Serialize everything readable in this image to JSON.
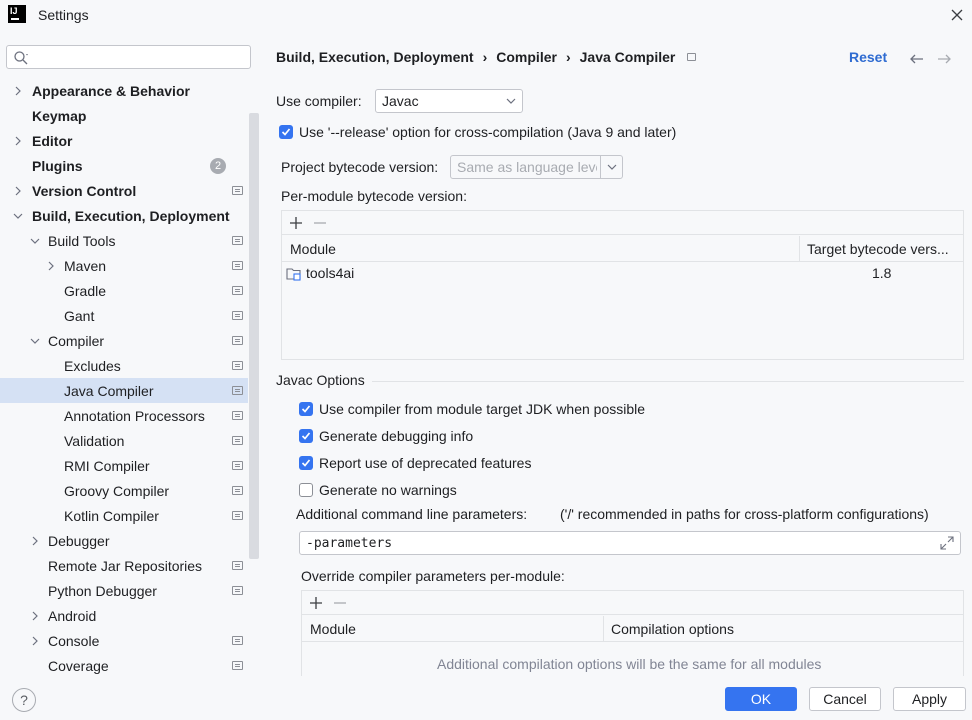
{
  "window": {
    "title": "Settings"
  },
  "sidebar": {
    "search_placeholder": "",
    "items": [
      {
        "label": "Appearance & Behavior"
      },
      {
        "label": "Keymap"
      },
      {
        "label": "Editor"
      },
      {
        "label": "Plugins",
        "badge": "2"
      },
      {
        "label": "Version Control"
      },
      {
        "label": "Build, Execution, Deployment"
      },
      {
        "label": "Build Tools"
      },
      {
        "label": "Maven"
      },
      {
        "label": "Gradle"
      },
      {
        "label": "Gant"
      },
      {
        "label": "Compiler"
      },
      {
        "label": "Excludes"
      },
      {
        "label": "Java Compiler"
      },
      {
        "label": "Annotation Processors"
      },
      {
        "label": "Validation"
      },
      {
        "label": "RMI Compiler"
      },
      {
        "label": "Groovy Compiler"
      },
      {
        "label": "Kotlin Compiler"
      },
      {
        "label": "Debugger"
      },
      {
        "label": "Remote Jar Repositories"
      },
      {
        "label": "Python Debugger"
      },
      {
        "label": "Android"
      },
      {
        "label": "Console"
      },
      {
        "label": "Coverage"
      }
    ]
  },
  "main": {
    "breadcrumb": [
      "Build, Execution, Deployment",
      "Compiler",
      "Java Compiler"
    ],
    "reset_label": "Reset",
    "use_compiler_label": "Use compiler:",
    "use_compiler_value": "Javac",
    "release_option_label": "Use '--release' option for cross-compilation (Java 9 and later)",
    "project_bytecode_label": "Project bytecode version:",
    "project_bytecode_value": "Same as language leve",
    "per_module_label": "Per-module bytecode version:",
    "module_table": {
      "columns": [
        "Module",
        "Target bytecode vers..."
      ],
      "rows": [
        {
          "module": "tools4ai",
          "target": "1.8"
        }
      ]
    },
    "javac_options_title": "Javac Options",
    "options": [
      {
        "label": "Use compiler from module target JDK when possible",
        "checked": true
      },
      {
        "label": "Generate debugging info",
        "checked": true
      },
      {
        "label": "Report use of deprecated features",
        "checked": true
      },
      {
        "label": "Generate no warnings",
        "checked": false
      }
    ],
    "additional_params_label": "Additional command line parameters:",
    "additional_params_hint": "('/' recommended in paths for cross-platform configurations)",
    "additional_params_value": "-parameters",
    "override_label": "Override compiler parameters per-module:",
    "override_table": {
      "columns": [
        "Module",
        "Compilation options"
      ],
      "empty_text": "Additional compilation options will be the same for all modules"
    }
  },
  "footer": {
    "help_label": "?",
    "ok_label": "OK",
    "cancel_label": "Cancel",
    "apply_label": "Apply"
  },
  "colors": {
    "accent": "#3574f0",
    "selection": "#d5e1f4",
    "link": "#2e6bd1"
  }
}
